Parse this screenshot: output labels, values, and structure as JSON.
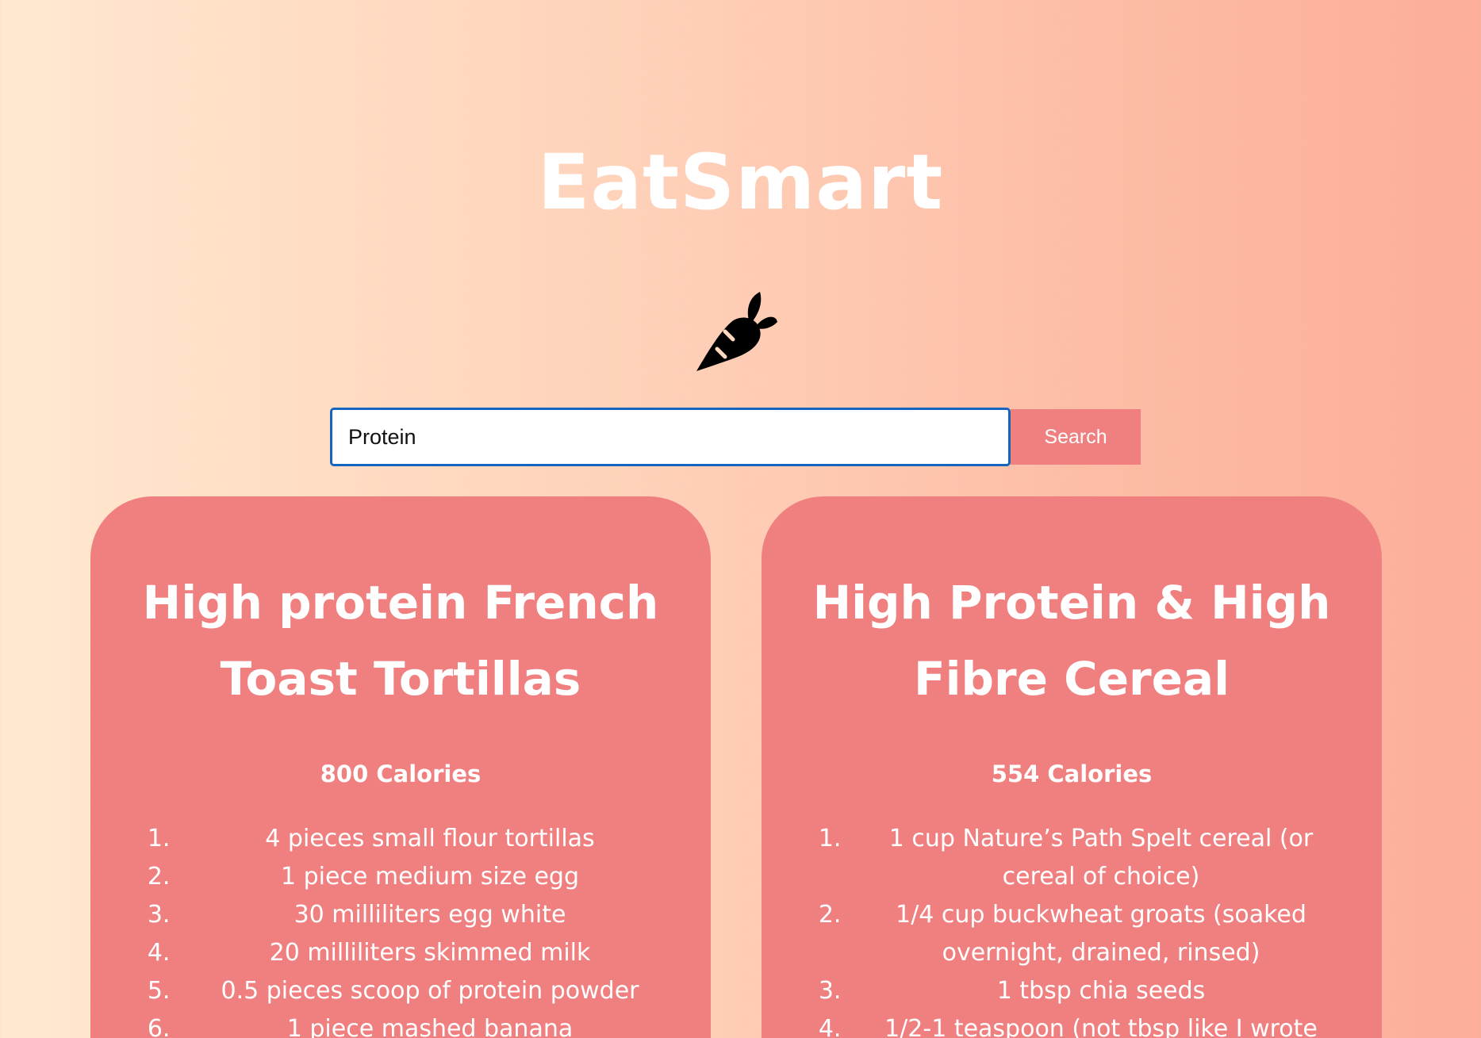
{
  "app": {
    "title": "EatSmart",
    "logo_icon": "carrot-icon"
  },
  "search": {
    "value": "Protein",
    "button_label": "Search"
  },
  "colors": {
    "accent": "#f08080",
    "input_focus": "#1565c0",
    "text": "#ffffff"
  },
  "recipes": [
    {
      "title": "High protein French Toast Tortillas",
      "calories": "800 Calories",
      "ingredients": [
        "4 pieces small flour tortillas",
        "1 piece medium size egg",
        "30 milliliters egg white",
        "20 milliliters skimmed milk",
        "0.5 pieces scoop of protein powder",
        "1 piece mashed banana"
      ]
    },
    {
      "title": "High Protein & High Fibre Cereal",
      "calories": "554 Calories",
      "ingredients": [
        "1 cup Nature’s Path Spelt cereal (or cereal of choice)",
        "1/4 cup buckwheat groats (soaked overnight, drained, rinsed)",
        "1 tbsp chia seeds",
        "1/2-1 teaspoon (not tbsp like I wrote"
      ]
    }
  ]
}
